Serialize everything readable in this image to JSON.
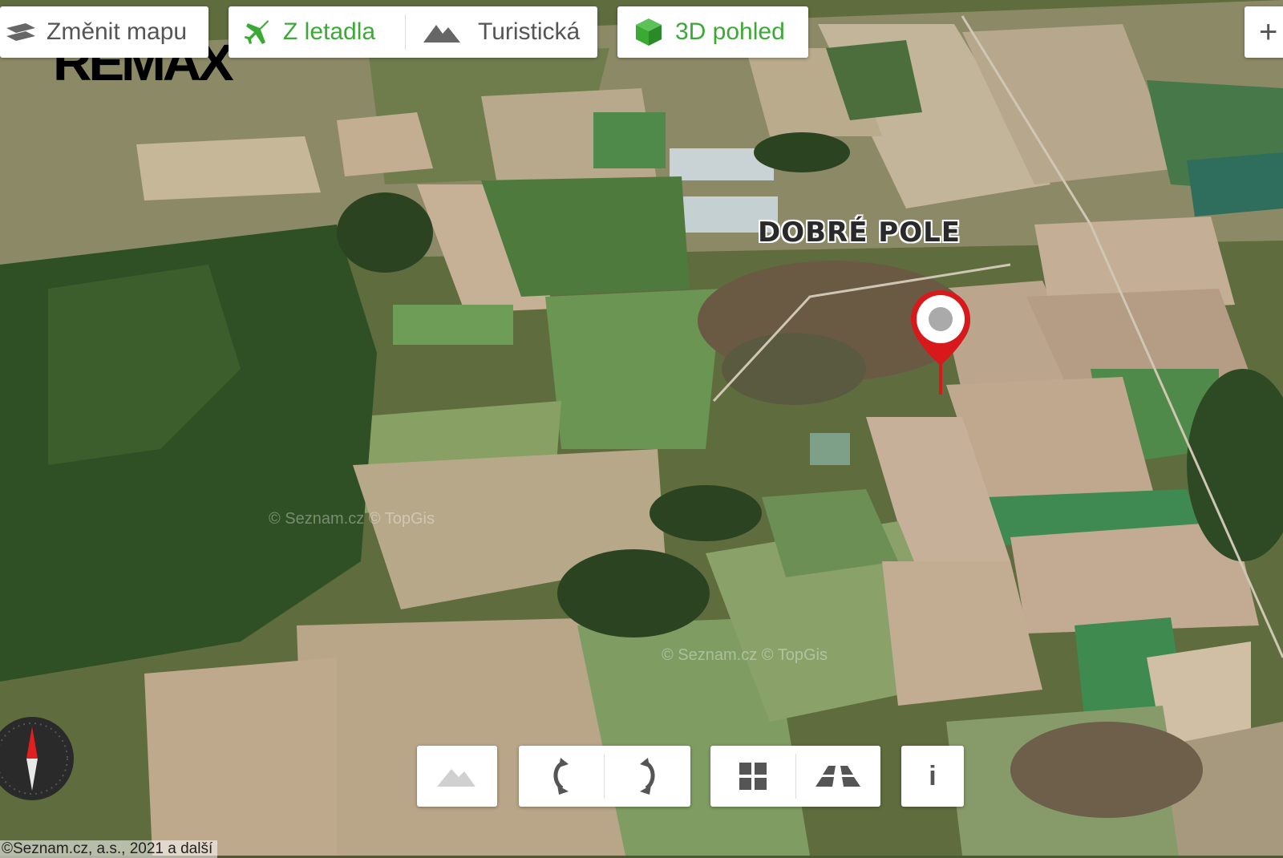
{
  "toolbar": {
    "change_map_label": "Změnit mapu",
    "aerial_label": "Z letadla",
    "tourist_label": "Turistická",
    "view3d_label": "3D pohled",
    "plus_label": "+"
  },
  "logo": {
    "text": "REMAX"
  },
  "map": {
    "place_label": "DOBRÉ POLE",
    "watermark": "© Seznam.cz  © TopGis",
    "marker_color": "#d7191c"
  },
  "controls": {
    "info_label": "i"
  },
  "footer": {
    "copyright": "©Seznam.cz, a.s., 2021 a další"
  },
  "colors": {
    "accent_green": "#3aaa35",
    "marker_red": "#d7191c"
  },
  "icons": [
    "layers-icon",
    "airplane-icon",
    "mountains-icon",
    "cube-icon",
    "compass-icon",
    "terrain-icon",
    "rotate-left-icon",
    "rotate-right-icon",
    "grid-icon",
    "perspective-icon",
    "info-icon"
  ]
}
